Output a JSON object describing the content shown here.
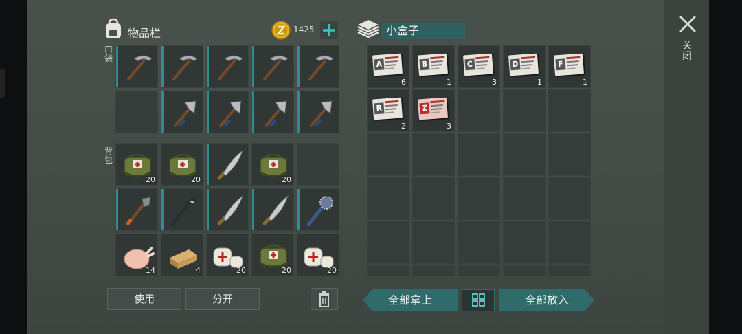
{
  "inventory": {
    "title": "物品栏",
    "coins": "1425",
    "pocket_label": "口袋",
    "backpack_label": "背包",
    "pocket": [
      {
        "item": "pickaxe-icon"
      },
      {
        "item": "pickaxe-icon"
      },
      {
        "item": "pickaxe-icon"
      },
      {
        "item": "pickaxe-icon"
      },
      {
        "item": "pickaxe-icon"
      },
      {
        "item": "empty"
      },
      {
        "item": "hatchet-icon"
      },
      {
        "item": "hatchet-icon"
      },
      {
        "item": "hatchet-icon"
      },
      {
        "item": "hatchet-icon"
      }
    ],
    "backpack": [
      {
        "item": "medkit-bag-icon",
        "count": "20"
      },
      {
        "item": "medkit-bag-icon",
        "count": "20"
      },
      {
        "item": "machete-icon",
        "count": ""
      },
      {
        "item": "medkit-bag-icon",
        "count": "20"
      },
      {
        "item": "empty",
        "count": ""
      },
      {
        "item": "shovel-icon",
        "count": ""
      },
      {
        "item": "crowbar-icon",
        "count": ""
      },
      {
        "item": "machete-icon",
        "count": ""
      },
      {
        "item": "machete-icon",
        "count": ""
      },
      {
        "item": "spiked-club-icon",
        "count": ""
      },
      {
        "item": "chicken-icon",
        "count": "14"
      },
      {
        "item": "wood-plank-icon",
        "count": "4"
      },
      {
        "item": "bandage-icon",
        "count": "20"
      },
      {
        "item": "medkit-bag-icon",
        "count": "20"
      },
      {
        "item": "bandage-icon",
        "count": "20"
      }
    ],
    "use_label": "使用",
    "split_label": "分开"
  },
  "container": {
    "name": "小盒子",
    "items": [
      {
        "letter": "A",
        "count": "6"
      },
      {
        "letter": "B",
        "count": "1"
      },
      {
        "letter": "C",
        "count": "3"
      },
      {
        "letter": "D",
        "count": "1"
      },
      {
        "letter": "F",
        "count": "1"
      },
      {
        "letter": "R",
        "count": "2"
      },
      {
        "letter": "Z",
        "count": "3"
      }
    ],
    "take_all_label": "全部拿上",
    "put_all_label": "全部放入"
  },
  "close_label": "关闭",
  "colors": {
    "accent": "#2f6b6a",
    "durability": "#2f8f8f",
    "coin": "#e0b020"
  }
}
